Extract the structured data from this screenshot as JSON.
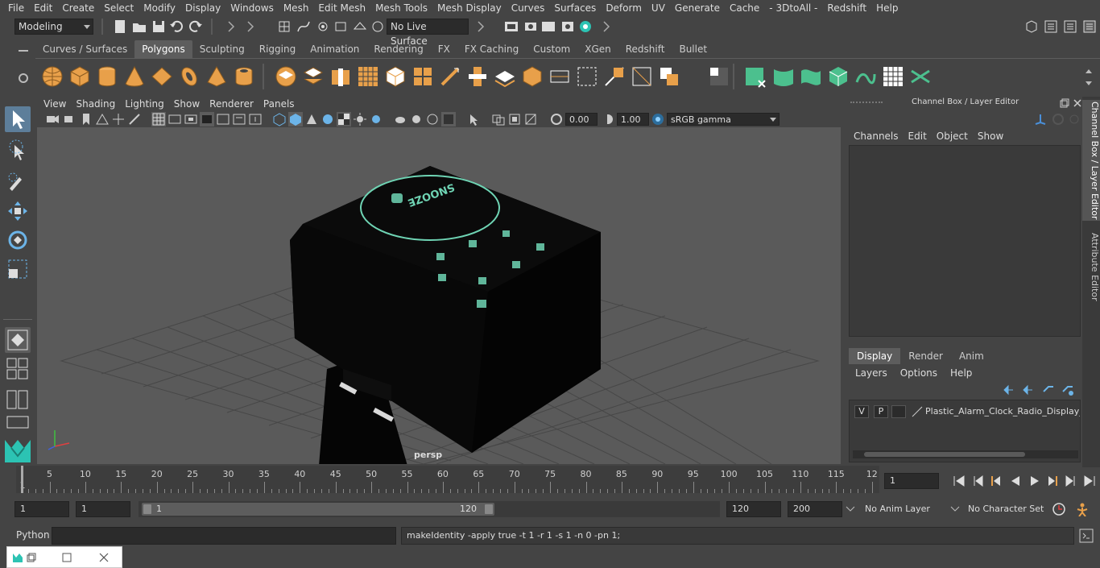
{
  "menubar": {
    "items": [
      "File",
      "Edit",
      "Create",
      "Select",
      "Modify",
      "Display",
      "Windows",
      "Mesh",
      "Edit Mesh",
      "Mesh Tools",
      "Mesh Display",
      "Curves",
      "Surfaces",
      "Deform",
      "UV",
      "Generate",
      "Cache",
      "- 3DtoAll -",
      "Redshift",
      "Help"
    ]
  },
  "statusline": {
    "mode": "Modeling",
    "live_surface": "No Live Surface"
  },
  "shelf": {
    "tabs": [
      "Curves / Surfaces",
      "Polygons",
      "Sculpting",
      "Rigging",
      "Animation",
      "Rendering",
      "FX",
      "FX Caching",
      "Custom",
      "XGen",
      "Redshift",
      "Bullet"
    ],
    "active": "Polygons"
  },
  "viewport": {
    "menu": [
      "View",
      "Shading",
      "Lighting",
      "Show",
      "Renderer",
      "Panels"
    ],
    "exposure": "0.00",
    "gamma": "1.00",
    "colorspace": "sRGB gamma",
    "camera_label": "persp",
    "model_text": "SNOOZE"
  },
  "channelbox": {
    "title": "Channel Box / Layer Editor",
    "menu": [
      "Channels",
      "Edit",
      "Object",
      "Show"
    ],
    "layer_tabs": [
      "Display",
      "Render",
      "Anim"
    ],
    "active_layer_tab": "Display",
    "layer_menu": [
      "Layers",
      "Options",
      "Help"
    ],
    "layer": {
      "v": "V",
      "p": "P",
      "name": "Plastic_Alarm_Clock_Radio_Display_O"
    },
    "side_tabs": [
      "Channel Box / Layer Editor",
      "Attribute Editor"
    ]
  },
  "timeline": {
    "ticks": [
      "5",
      "10",
      "15",
      "20",
      "25",
      "30",
      "35",
      "40",
      "45",
      "50",
      "55",
      "60",
      "65",
      "70",
      "75",
      "80",
      "85",
      "90",
      "95",
      "100",
      "105",
      "110",
      "115",
      "12"
    ],
    "start_marker": "1",
    "current_frame": "1"
  },
  "range": {
    "start": "1",
    "playback_start": "1",
    "slider_start": "1",
    "slider_end": "120",
    "playback_end": "120",
    "end": "200",
    "anim_layer": "No Anim Layer",
    "character_set": "No Character Set"
  },
  "cmdline": {
    "language": "Python",
    "result": "makeIdentity -apply true -t 1 -r 1 -s 1 -n 0 -pn 1;"
  },
  "colors": {
    "accent_teal": "#2cc3b3",
    "shelf_orange": "#e8a04a",
    "shelf_green": "#4cc08e",
    "active_tab": "#5d5d5d"
  }
}
